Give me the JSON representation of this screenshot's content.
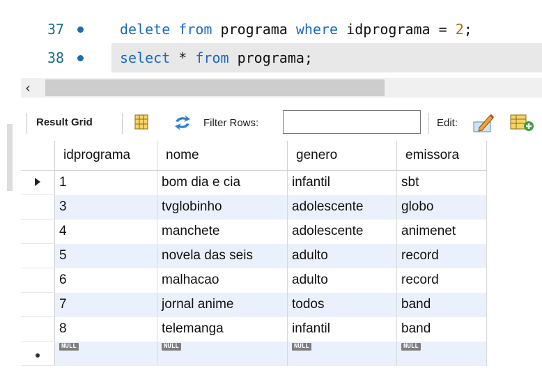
{
  "editor": {
    "lines": [
      {
        "number": "37",
        "tokens": [
          {
            "t": "delete",
            "k": "kw"
          },
          {
            "t": " ",
            "k": "id"
          },
          {
            "t": "from",
            "k": "kw"
          },
          {
            "t": " programa ",
            "k": "id"
          },
          {
            "t": "where",
            "k": "kw"
          },
          {
            "t": " idprograma ",
            "k": "id"
          },
          {
            "t": "=",
            "k": "op"
          },
          {
            "t": " ",
            "k": "id"
          },
          {
            "t": "2",
            "k": "num"
          },
          {
            "t": ";",
            "k": "id"
          }
        ]
      },
      {
        "number": "38",
        "tokens": [
          {
            "t": "select",
            "k": "kw"
          },
          {
            "t": " * ",
            "k": "id"
          },
          {
            "t": "from",
            "k": "kw"
          },
          {
            "t": " programa;",
            "k": "id"
          }
        ]
      }
    ]
  },
  "toolbar": {
    "result_grid_label": "Result Grid",
    "filter_rows_label": "Filter Rows:",
    "filter_value": "",
    "edit_label": "Edit:"
  },
  "grid": {
    "columns": [
      "idprograma",
      "nome",
      "genero",
      "emissora"
    ],
    "rows": [
      [
        "1",
        "bom dia e cia",
        "infantil",
        "sbt"
      ],
      [
        "3",
        "tvglobinho",
        "adolescente",
        "globo"
      ],
      [
        "4",
        "manchete",
        "adolescente",
        "animenet"
      ],
      [
        "5",
        "novela das seis",
        "adulto",
        "record"
      ],
      [
        "6",
        "malhacao",
        "adulto",
        "record"
      ],
      [
        "7",
        "jornal anime",
        "todos",
        "band"
      ],
      [
        "8",
        "telemanga",
        "infantil",
        "band"
      ]
    ],
    "null_label": "NULL"
  },
  "colors": {
    "keyword": "#1a6ac4",
    "number": "#b36a00",
    "alt_row": "#eaf1fc"
  }
}
